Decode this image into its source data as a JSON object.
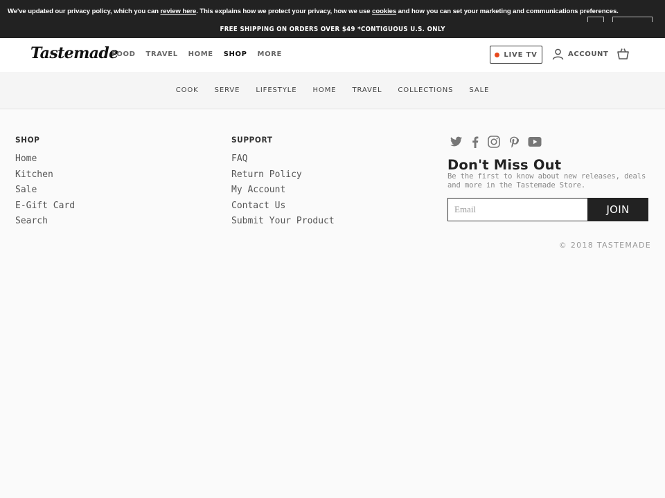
{
  "privacy_banner": {
    "text_before": "We've updated our privacy policy, which you can ",
    "review_link": "review here",
    "text_middle": ". This explains how we protect your privacy, how we use ",
    "cookies_link": "cookies",
    "text_after": " and how you can set your marketing and communications preferences."
  },
  "shipping_bar": {
    "text": "FREE SHIPPING ON ORDERS OVER $49 *CONTIGUOUS U.S. ONLY"
  },
  "header": {
    "logo": "Tastemade",
    "nav": [
      "FOOD",
      "TRAVEL",
      "HOME",
      "SHOP",
      "MORE"
    ],
    "active_nav": "SHOP",
    "live_tv": "LIVE TV",
    "account": "ACCOUNT"
  },
  "shop_nav": [
    "COOK",
    "SERVE",
    "LIFESTYLE",
    "HOME",
    "TRAVEL",
    "COLLECTIONS",
    "SALE"
  ],
  "footer": {
    "shop": {
      "title": "SHOP",
      "links": [
        "Home",
        "Kitchen",
        "Sale",
        "E-Gift Card",
        "Search"
      ]
    },
    "support": {
      "title": "SUPPORT",
      "links": [
        "FAQ",
        "Return Policy",
        "My Account",
        "Contact Us",
        "Submit Your Product"
      ]
    },
    "social_icons": [
      "twitter-icon",
      "facebook-icon",
      "instagram-icon",
      "pinterest-icon",
      "youtube-icon"
    ],
    "newsletter": {
      "title": "Don't Miss Out",
      "description": "Be the first to know about new releases, deals and more in the Tastemade Store.",
      "email_placeholder": "Email",
      "join_label": "JOIN"
    },
    "copyright": "© 2018 TASTEMADE"
  },
  "colors": {
    "dark_bar": "#222222",
    "live_dot": "#e8481c",
    "page_bg": "#fafafa",
    "subnav_bg": "#f5f5f5"
  }
}
